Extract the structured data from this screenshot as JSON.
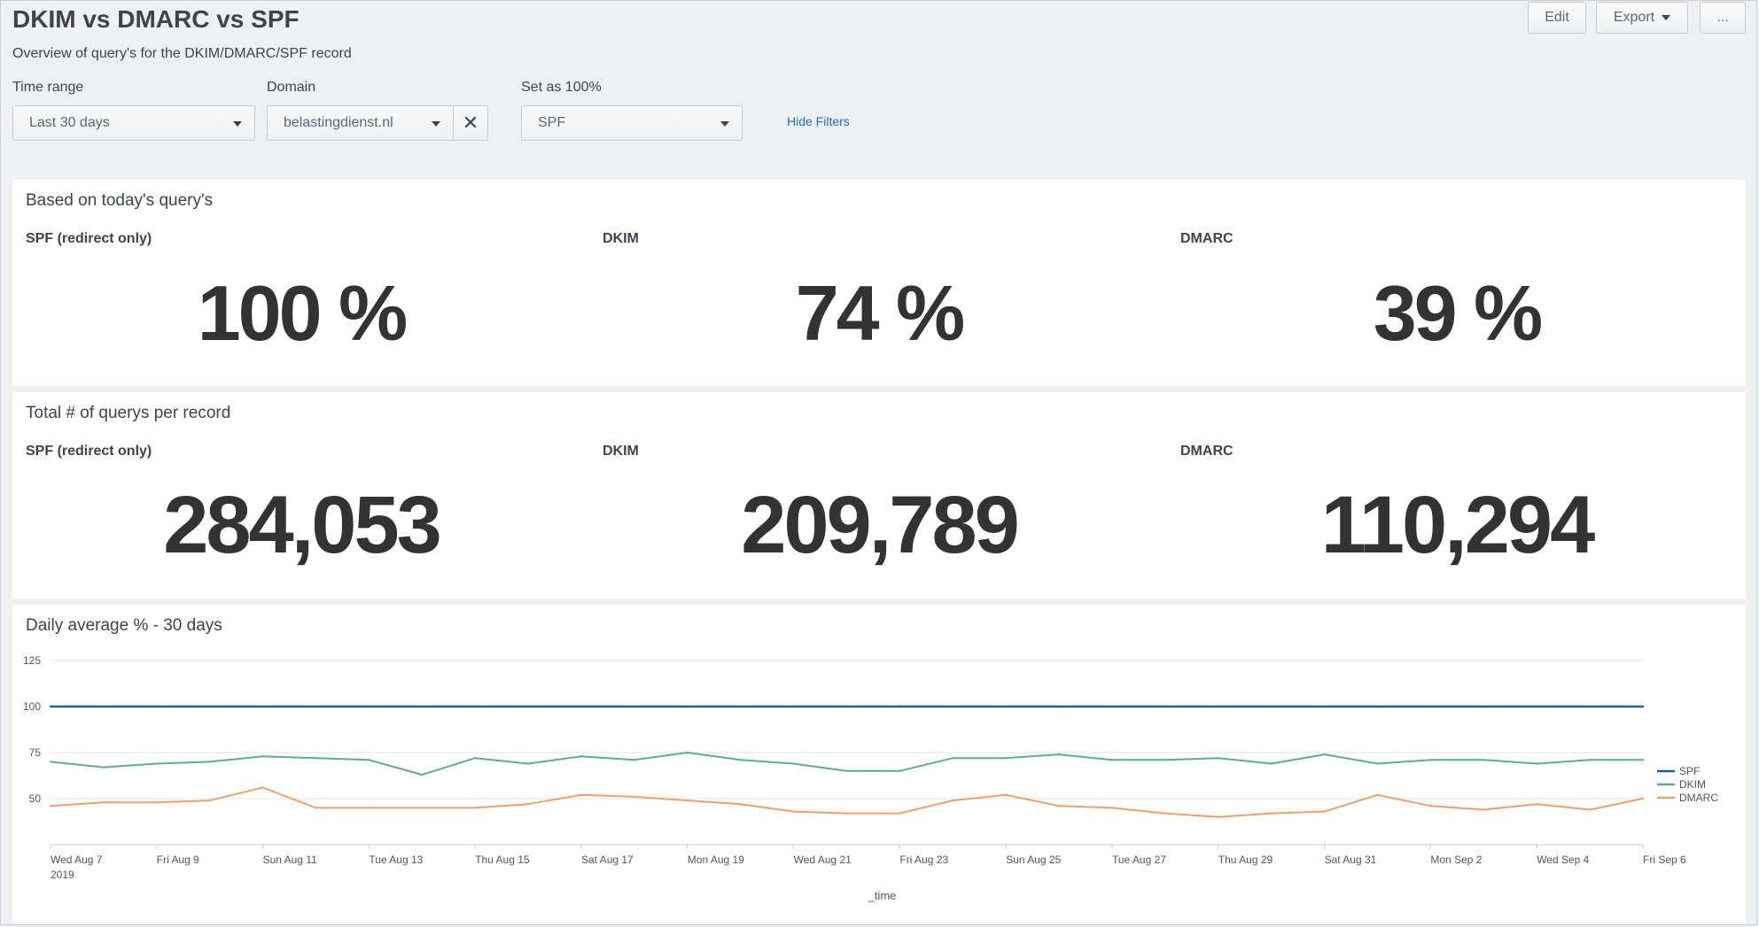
{
  "header": {
    "title": "DKIM vs DMARC vs SPF",
    "description": "Overview of query's for the DKIM/DMARC/SPF record",
    "edit_label": "Edit",
    "export_label": "Export",
    "more_label": "..."
  },
  "filters": {
    "time_range": {
      "label": "Time range",
      "value": "Last 30 days"
    },
    "domain": {
      "label": "Domain",
      "value": "belastingdienst.nl"
    },
    "set_as": {
      "label": "Set as 100%",
      "value": "SPF"
    },
    "hide_filters_label": "Hide Filters"
  },
  "panel_percent": {
    "title": "Based on today's query's",
    "items": [
      {
        "label": "SPF (redirect only)",
        "value": "100 %"
      },
      {
        "label": "DKIM",
        "value": "74 %"
      },
      {
        "label": "DMARC",
        "value": "39 %"
      }
    ]
  },
  "panel_total": {
    "title": "Total # of querys per record",
    "items": [
      {
        "label": "SPF (redirect only)",
        "value": "284,053"
      },
      {
        "label": "DKIM",
        "value": "209,789"
      },
      {
        "label": "DMARC",
        "value": "110,294"
      }
    ]
  },
  "panel_chart": {
    "title": "Daily average % - 30 days"
  },
  "chart_data": {
    "type": "line",
    "title": "Daily average % - 30 days",
    "xlabel": "_time",
    "ylabel": "",
    "ylim": [
      25,
      125
    ],
    "yticks": [
      50,
      75,
      100,
      125
    ],
    "grid": true,
    "legend_position": "right",
    "x": [
      "Aug 7",
      "Aug 8",
      "Aug 9",
      "Aug 10",
      "Aug 11",
      "Aug 12",
      "Aug 13",
      "Aug 14",
      "Aug 15",
      "Aug 16",
      "Aug 17",
      "Aug 18",
      "Aug 19",
      "Aug 20",
      "Aug 21",
      "Aug 22",
      "Aug 23",
      "Aug 24",
      "Aug 25",
      "Aug 26",
      "Aug 27",
      "Aug 28",
      "Aug 29",
      "Aug 30",
      "Aug 31",
      "Sep 1",
      "Sep 2",
      "Sep 3",
      "Sep 4",
      "Sep 5",
      "Sep 6"
    ],
    "x_tick_labels": [
      [
        "Wed Aug 7",
        "2019"
      ],
      [
        "Fri Aug 9"
      ],
      [
        "Sun Aug 11"
      ],
      [
        "Tue Aug 13"
      ],
      [
        "Thu Aug 15"
      ],
      [
        "Sat Aug 17"
      ],
      [
        "Mon Aug 19"
      ],
      [
        "Wed Aug 21"
      ],
      [
        "Fri Aug 23"
      ],
      [
        "Sun Aug 25"
      ],
      [
        "Tue Aug 27"
      ],
      [
        "Thu Aug 29"
      ],
      [
        "Sat Aug 31"
      ],
      [
        "Mon Sep 2"
      ],
      [
        "Wed Sep 4"
      ],
      [
        "Fri Sep 6"
      ]
    ],
    "series": [
      {
        "name": "SPF",
        "color": "#1e5f8c",
        "values": [
          100,
          100,
          100,
          100,
          100,
          100,
          100,
          100,
          100,
          100,
          100,
          100,
          100,
          100,
          100,
          100,
          100,
          100,
          100,
          100,
          100,
          100,
          100,
          100,
          100,
          100,
          100,
          100,
          100,
          100,
          100
        ]
      },
      {
        "name": "DKIM",
        "color": "#5fad8f",
        "values": [
          70,
          67,
          69,
          70,
          73,
          72,
          71,
          63,
          72,
          69,
          73,
          71,
          75,
          71,
          69,
          65,
          65,
          72,
          72,
          74,
          71,
          71,
          72,
          69,
          74,
          69,
          71,
          71,
          69,
          71,
          71
        ]
      },
      {
        "name": "DMARC",
        "color": "#f0a070",
        "values": [
          46,
          48,
          48,
          49,
          56,
          45,
          45,
          45,
          45,
          47,
          52,
          51,
          49,
          47,
          43,
          42,
          42,
          49,
          52,
          46,
          45,
          42,
          40,
          42,
          43,
          52,
          46,
          44,
          47,
          44,
          50
        ]
      }
    ]
  }
}
